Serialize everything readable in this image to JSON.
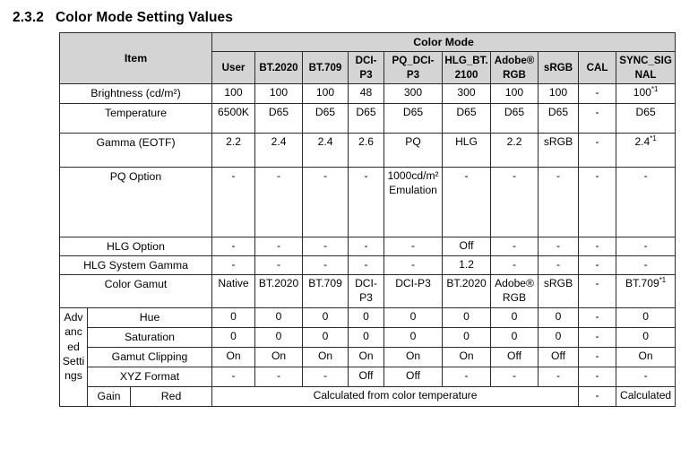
{
  "heading": {
    "number": "2.3.2",
    "title": "Color Mode Setting Values"
  },
  "table": {
    "item_header": "Item",
    "group_header": "Color Mode",
    "columns": [
      "User",
      "BT.2020",
      "BT.709",
      "DCI-P3",
      "PQ_DCI-P3",
      "HLG_BT.2100",
      "Adobe®RGB",
      "sRGB",
      "CAL",
      "SYNC_SIGNAL"
    ],
    "rows": [
      {
        "label": "Brightness (cd/m²)",
        "values": [
          "100",
          "100",
          "100",
          "48",
          "300",
          "300",
          "100",
          "100",
          "-",
          "100*1"
        ]
      },
      {
        "label": "Temperature",
        "values": [
          "6500K",
          "D65",
          "D65",
          "D65",
          "D65",
          "D65",
          "D65",
          "D65",
          "-",
          "D65"
        ]
      },
      {
        "label": "Gamma (EOTF)",
        "values": [
          "2.2",
          "2.4",
          "2.4",
          "2.6",
          "PQ",
          "HLG",
          "2.2",
          "sRGB",
          "-",
          "2.4*1"
        ]
      },
      {
        "label": "PQ Option",
        "values": [
          "-",
          "-",
          "-",
          "-",
          "1000cd/m² Emulation",
          "-",
          "-",
          "-",
          "-",
          "-"
        ]
      },
      {
        "label": "HLG Option",
        "values": [
          "-",
          "-",
          "-",
          "-",
          "-",
          "Off",
          "-",
          "-",
          "-",
          "-"
        ]
      },
      {
        "label": "HLG System Gamma",
        "values": [
          "-",
          "-",
          "-",
          "-",
          "-",
          "1.2",
          "-",
          "-",
          "-",
          "-"
        ]
      },
      {
        "label": "Color Gamut",
        "values": [
          "Native",
          "BT.2020",
          "BT.709",
          "DCI-P3",
          "DCI-P3",
          "BT.2020",
          "Adobe®RGB",
          "sRGB",
          "-",
          "BT.709*1"
        ]
      }
    ],
    "advanced_group_label": "Advanced Settings",
    "advanced_rows": [
      {
        "label": "Hue",
        "values": [
          "0",
          "0",
          "0",
          "0",
          "0",
          "0",
          "0",
          "0",
          "-",
          "0"
        ]
      },
      {
        "label": "Saturation",
        "values": [
          "0",
          "0",
          "0",
          "0",
          "0",
          "0",
          "0",
          "0",
          "-",
          "0"
        ]
      },
      {
        "label": "Gamut Clipping",
        "values": [
          "On",
          "On",
          "On",
          "On",
          "On",
          "On",
          "Off",
          "Off",
          "-",
          "On"
        ]
      },
      {
        "label": "XYZ Format",
        "values": [
          "-",
          "-",
          "-",
          "Off",
          "Off",
          "-",
          "-",
          "-",
          "-",
          "-"
        ]
      }
    ],
    "gain_row": {
      "group_label": "Gain",
      "label": "Red",
      "merged_value": "Calculated from color temperature",
      "cal_value": "-",
      "sync_value": "Calculated"
    }
  }
}
